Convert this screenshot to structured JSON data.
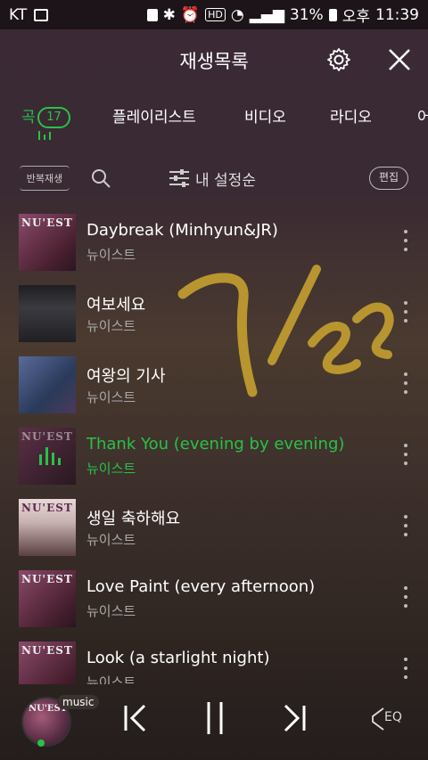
{
  "status_bar": {
    "carrier": "KT",
    "battery": "31%",
    "ampm": "오후",
    "time": "11:39"
  },
  "header": {
    "title": "재생목록"
  },
  "tabs": [
    {
      "label": "곡",
      "count": "17",
      "active": true
    },
    {
      "label": "플레이리스트"
    },
    {
      "label": "비디오"
    },
    {
      "label": "라디오"
    },
    {
      "label": "어"
    }
  ],
  "toolbar": {
    "repeat_label": "반복재생",
    "sort_label": "내 설정순",
    "edit_label": "편집"
  },
  "tracks": [
    {
      "title": "Daybreak (Minhyun&JR)",
      "artist": "뉴이스트",
      "art_text": "NU'EST",
      "art_color": "#6b3550"
    },
    {
      "title": "여보세요",
      "artist": "뉴이스트",
      "art_text": "",
      "art_color": "#2a2a2e"
    },
    {
      "title": "여왕의 기사",
      "artist": "뉴이스트",
      "art_text": "",
      "art_color": "#3a4a6a"
    },
    {
      "title": "Thank You (evening by evening)",
      "artist": "뉴이스트",
      "art_text": "NU'EST",
      "art_color": "#4a2b3a",
      "playing": true
    },
    {
      "title": "생일 축하해요",
      "artist": "뉴이스트",
      "art_text": "NU'EST",
      "art_color": "#d9c9c9"
    },
    {
      "title": "Love Paint (every afternoon)",
      "artist": "뉴이스트",
      "art_text": "NU'EST",
      "art_color": "#6b3550"
    },
    {
      "title": "Look (a starlight night)",
      "artist": "뉴이스트",
      "art_text": "NU'EST",
      "art_color": "#6b3550"
    }
  ],
  "player": {
    "art_text": "NU'EST",
    "badge": "music",
    "eq_label": "EQ"
  },
  "handwriting": "7/22",
  "colors": {
    "accent": "#27c247",
    "handwriting": "#b8952f"
  }
}
